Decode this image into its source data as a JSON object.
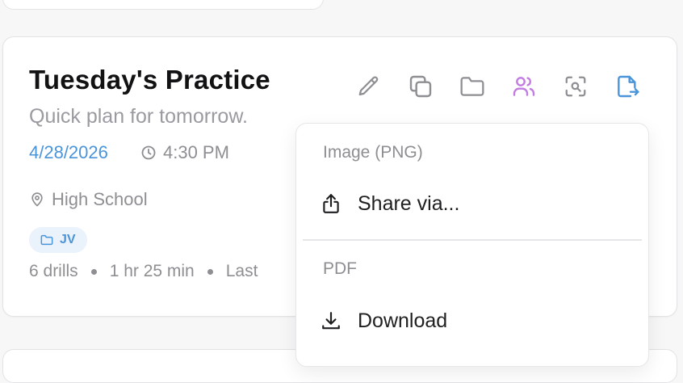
{
  "card": {
    "title": "Tuesday's Practice",
    "subtitle": "Quick plan for tomorrow.",
    "date": "4/28/2026",
    "time": "4:30 PM",
    "location": "High School",
    "tag": "JV",
    "stats": {
      "drills": "6 drills",
      "duration": "1 hr 25 min",
      "last": "Last"
    },
    "actions": [
      "pencil-icon",
      "copy-icon",
      "folder-icon",
      "users-icon",
      "scan-icon",
      "export-icon"
    ]
  },
  "colors": {
    "accent_blue": "#4a94da",
    "accent_purple": "#c27be0",
    "muted_gray": "#8e8e93",
    "tag_bg": "#eaf2fb"
  },
  "export_menu": {
    "image_header": "Image (PNG)",
    "share_label": "Share via...",
    "pdf_header": "PDF",
    "download_label": "Download"
  }
}
